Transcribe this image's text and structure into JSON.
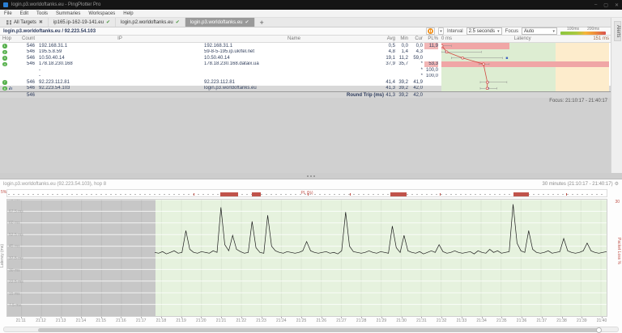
{
  "window": {
    "title": "login.p3.worldoftanks.eu - PingPlotter Pro"
  },
  "menu": {
    "items": [
      "File",
      "Edit",
      "Tools",
      "Summaries",
      "Workspaces",
      "Help"
    ]
  },
  "tabs": {
    "overview_label": "All Targets",
    "targets": [
      {
        "label": "ip165.ip-162-19-141.eu",
        "active": false
      },
      {
        "label": "login.p2.worldoftanks.eu",
        "active": false
      },
      {
        "label": "login.p3.worldoftanks.eu",
        "active": true
      }
    ],
    "add_label": "+"
  },
  "toolbar": {
    "target_title": "login.p3.worldoftanks.eu / 92.223.54.103",
    "interval_label": "Interval",
    "interval_value": "2.5 seconds",
    "focus_label": "Focus",
    "focus_value": "Auto",
    "legend_100": "100ms",
    "legend_200": "200ms"
  },
  "alerts_tab": "Alerts",
  "table": {
    "headers": {
      "hop": "Hop",
      "count": "Count",
      "ip": "IP",
      "name": "Name",
      "avg": "Avg",
      "min": "Min",
      "cur": "Cur",
      "pl": "PL%"
    },
    "latency_header": {
      "left": "0 ms",
      "center": "Latency",
      "right": "151 ms"
    },
    "scale": {
      "min_ms": 0,
      "max_ms": 151,
      "green_to_ms": 103
    },
    "rows": [
      {
        "hop": "1",
        "count": "546",
        "ip": "192.168.31.1",
        "name": "192.168.31.1",
        "avg": "0,5",
        "min": "0,0",
        "cur": "0,0",
        "pl": "11,9",
        "pl_alert": true,
        "band": "partial",
        "band_end_ms": 61,
        "point": {
          "avg": 0.5,
          "cur": 0,
          "lo": 0,
          "hi": 9
        }
      },
      {
        "hop": "2",
        "count": "546",
        "ip": "195.5.8.59",
        "name": "59-8-5-195.ip.ukrtel.net",
        "avg": "4,8",
        "min": "1,4",
        "cur": "4,3",
        "pl": "",
        "point": {
          "avg": 4.8,
          "cur": 4.3,
          "lo": 0,
          "hi": 36
        }
      },
      {
        "hop": "3",
        "count": "546",
        "ip": "10.50.40.14",
        "name": "10.50.40.14",
        "avg": "19,1",
        "min": "11,2",
        "cur": "59,0",
        "pl": "",
        "point": {
          "avg": 19.1,
          "cur": 59,
          "lo": 9,
          "hi": 55
        }
      },
      {
        "hop": "4",
        "count": "546",
        "ip": "178.18.230.168",
        "name": "178.18.230.168.dataix.ua",
        "avg": "37,9",
        "min": "35,7",
        "cur": "*",
        "pl": "53,3",
        "pl_alert": true,
        "band": "full",
        "point": {
          "avg": 37.9,
          "lo": 34,
          "hi": 43
        }
      },
      {
        "hop": "5",
        "count": "",
        "ip": "-",
        "name": "",
        "avg": "",
        "min": "",
        "cur": "*",
        "pl": "100,0"
      },
      {
        "hop": "6",
        "count": "",
        "ip": "-",
        "name": "",
        "avg": "",
        "min": "",
        "cur": "*",
        "pl": "100,0"
      },
      {
        "hop": "7",
        "count": "546",
        "ip": "92.223.112.81",
        "name": "92.223.112.81",
        "avg": "41,4",
        "min": "39,2",
        "cur": "41,9",
        "pl": "",
        "point": {
          "avg": 41.4,
          "cur": 41.9,
          "lo": 35,
          "hi": 59
        }
      },
      {
        "hop": "8",
        "count": "546",
        "ip": "92.223.54.103",
        "name": "login.p3.worldoftanks.eu",
        "avg": "41,3",
        "min": "39,2",
        "cur": "42,0",
        "pl": "",
        "selected": true,
        "graph_icon": true,
        "point": {
          "avg": 41.3,
          "cur": 42,
          "lo": 35,
          "hi": 50
        }
      }
    ],
    "round_trip": {
      "count": "546",
      "label": "Round Trip (ms)",
      "avg": "41,3",
      "min": "39,2",
      "cur": "42,0"
    },
    "focus_line": "Focus: 21:10:17 - 21:40:17"
  },
  "timeline": {
    "title": "login.p3.worldoftanks.eu (92.223.54.103), hop 8",
    "range_label": "30 minutes (21:10:17 - 21:40:17)",
    "pl_strip_label": "PL (%)",
    "pl_left_label": "5%",
    "pl_right_top_label": "30",
    "pl_axis_label": "Packet Loss %",
    "y_axis_label": "Latency (ms)",
    "scale_max_ms": 75,
    "y_ticks": [
      {
        "v": 75,
        "t": "75 ms"
      },
      {
        "v": 67.5,
        "t": "67.5 ms"
      },
      {
        "v": 60,
        "t": "60 ms"
      },
      {
        "v": 52.5,
        "t": "52.5 ms"
      },
      {
        "v": 45,
        "t": "45 ms"
      },
      {
        "v": 37.5,
        "t": "37.5 ms"
      },
      {
        "v": 30,
        "t": "30 ms"
      },
      {
        "v": 22.5,
        "t": "22.5 ms"
      },
      {
        "v": 15,
        "t": "15 ms"
      },
      {
        "v": 7.5,
        "t": "7.5 ms"
      }
    ],
    "x_ticks": [
      "21:11",
      "21:12",
      "21:13",
      "21:14",
      "21:15",
      "21:16",
      "21:17",
      "21:18",
      "21:19",
      "21:20",
      "21:21",
      "21:22",
      "21:23",
      "21:24",
      "21:25",
      "21:26",
      "21:27",
      "21:28",
      "21:29",
      "21:30",
      "21:31",
      "21:32",
      "21:33",
      "21:34",
      "21:35",
      "21:36",
      "21:37",
      "21:38",
      "21:39",
      "21:40"
    ],
    "data_start_fraction": 0.246,
    "pl_blocks": [
      [
        0.355,
        0.384
      ],
      [
        0.407,
        0.422
      ],
      [
        0.637,
        0.665
      ],
      [
        0.842,
        0.868
      ]
    ],
    "pl_ticks": [
      0.31,
      0.5,
      0.57,
      0.72,
      0.93
    ],
    "trace_ms": [
      41,
      40.5,
      41.5,
      40,
      41,
      42,
      40.5,
      41,
      55,
      43,
      41,
      40.5,
      41.5,
      41,
      40.5,
      42,
      41,
      70,
      46,
      42,
      52,
      43,
      41.5,
      40.5,
      41,
      61,
      44,
      41,
      40.5,
      65,
      45,
      42,
      41,
      40.5,
      41.5,
      41,
      40.5,
      41,
      42,
      48,
      42,
      41,
      40.5,
      41,
      41.5,
      40.5,
      41,
      40,
      42,
      67,
      45,
      41.5,
      41,
      40.5,
      41,
      42,
      41,
      40.5,
      41.5,
      41,
      40.5,
      58,
      44,
      41,
      52,
      42,
      41,
      40.5,
      41.5,
      40,
      41,
      42,
      41,
      46,
      41.5,
      40.5,
      41,
      42,
      41,
      40.5,
      41,
      41.5,
      40,
      42,
      41,
      40.5,
      43,
      41,
      42,
      40.5,
      41,
      41.5,
      72,
      47,
      42,
      41,
      55,
      43,
      41,
      40.5,
      41,
      42,
      40.5,
      41,
      41.5,
      50,
      42,
      41,
      40.5,
      41,
      42,
      47,
      42,
      41,
      40.5,
      41,
      41.5
    ],
    "scrollbar": {
      "start_fraction": 0.055,
      "end_fraction": 0.97
    }
  }
}
